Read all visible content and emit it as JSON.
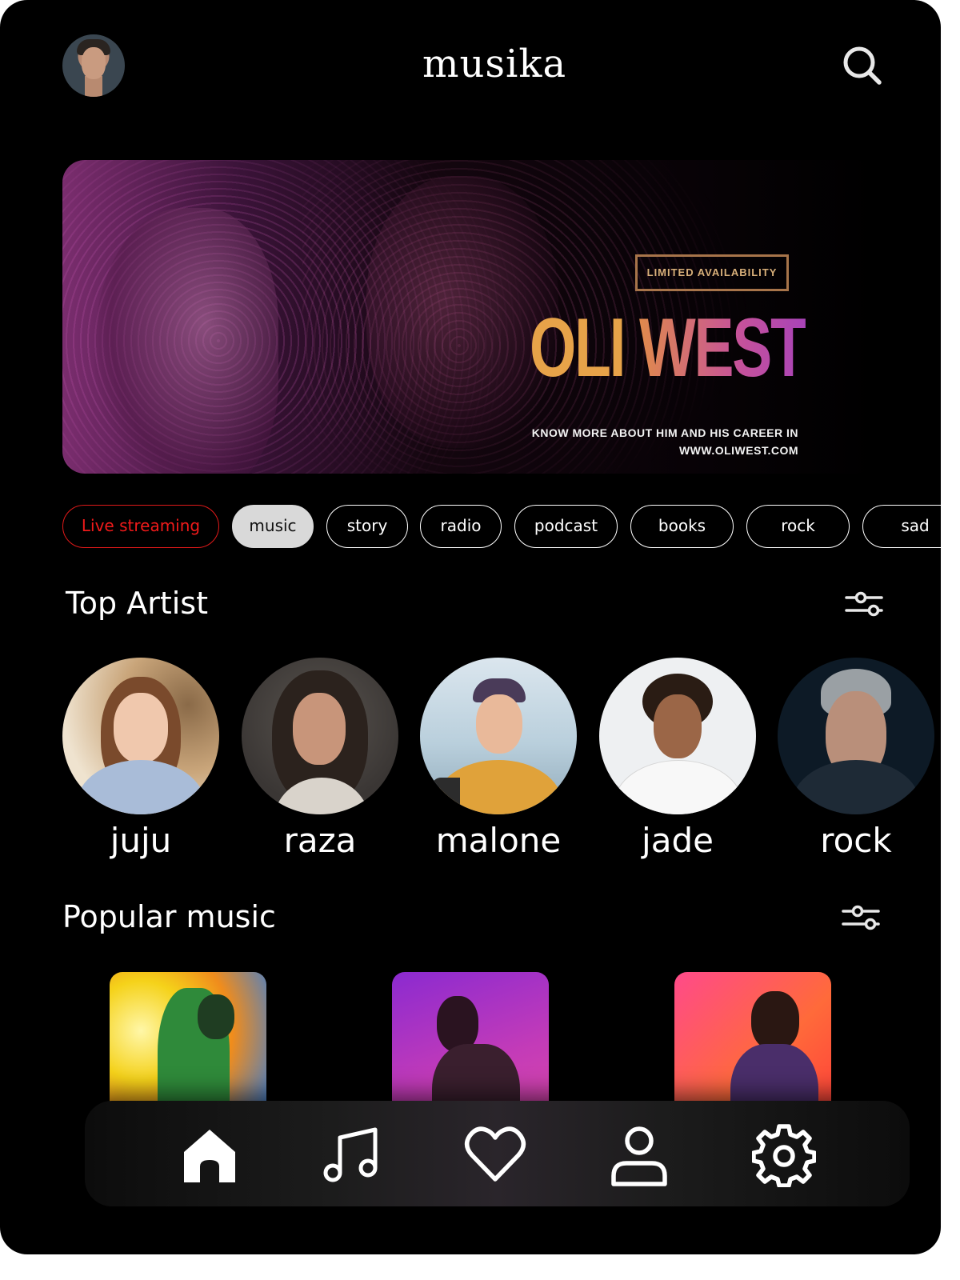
{
  "header": {
    "title": "musika",
    "search_icon": "search-icon"
  },
  "banner": {
    "badge": "LIMITED AVAILABILITY",
    "headline_first": "OLI",
    "headline_second": "WEST",
    "tagline_line1": "KNOW MORE ABOUT HIM AND HIS CAREER IN",
    "tagline_line2": "WWW.OLIWEST.COM"
  },
  "categories": [
    {
      "label": "Live streaming",
      "state": "live"
    },
    {
      "label": "music",
      "state": "selected"
    },
    {
      "label": "story",
      "state": "default"
    },
    {
      "label": "radio",
      "state": "default"
    },
    {
      "label": "podcast",
      "state": "default"
    },
    {
      "label": "books",
      "state": "default"
    },
    {
      "label": "rock",
      "state": "default"
    },
    {
      "label": "sad",
      "state": "default"
    }
  ],
  "top_artist": {
    "title": "Top Artist",
    "artists": [
      {
        "name": "juju"
      },
      {
        "name": "raza"
      },
      {
        "name": "malone"
      },
      {
        "name": "jade"
      },
      {
        "name": "rock"
      }
    ]
  },
  "popular_music": {
    "title": "Popular music"
  },
  "bottom_nav": {
    "items": [
      "home-icon",
      "music-note-icon",
      "heart-icon",
      "user-icon",
      "gear-icon"
    ],
    "active": "home-icon"
  },
  "colors": {
    "background": "#000000",
    "live_accent": "#ef1a1a",
    "selected_chip": "#d9d9d9",
    "headline_orange": "#e7a349",
    "headline_magenta": "#c6529a"
  }
}
